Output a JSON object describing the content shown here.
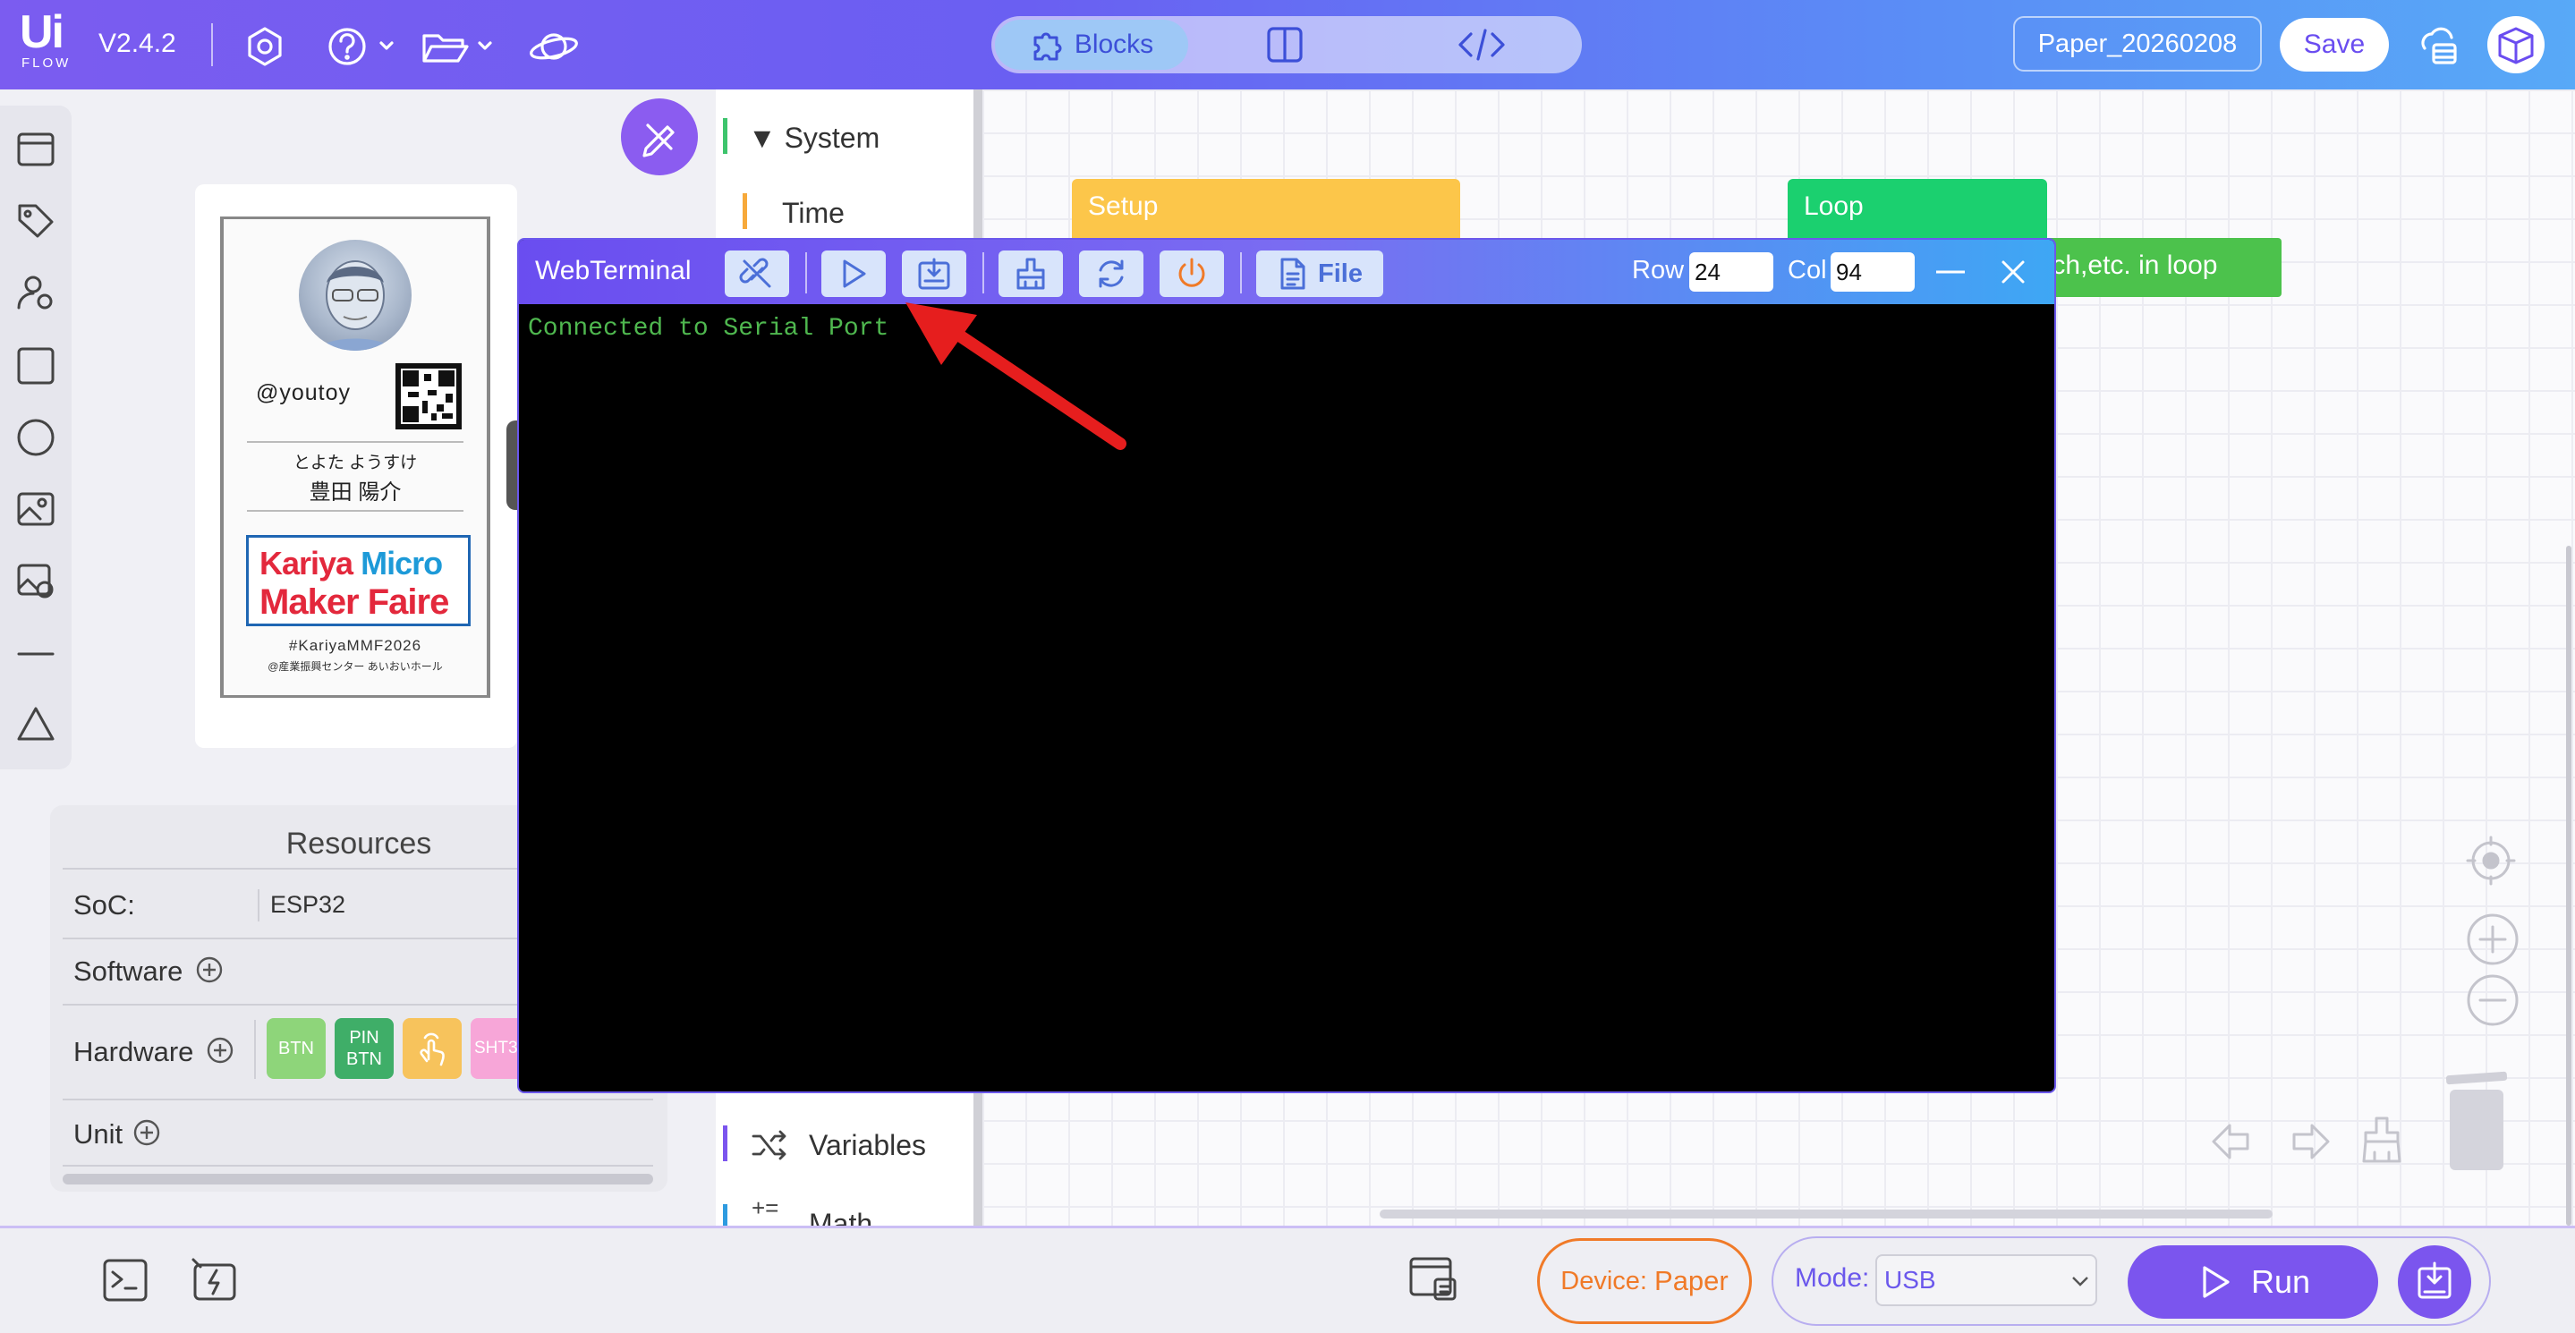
{
  "app": {
    "logo_top": "Ui",
    "logo_bottom": "FLOW",
    "version": "V2.4.2"
  },
  "view_tabs": {
    "blocks_label": "Blocks"
  },
  "header": {
    "project_name": "Paper_20260208",
    "save_label": "Save"
  },
  "preview": {
    "handle": "@youtoy",
    "name_kana": "とよた ようすけ",
    "name_kanji": "豊田 陽介",
    "logo_line1_a": "Kariya",
    "logo_line1_b": "Micro",
    "logo_line2": "Maker Faire",
    "hashtag": "#KariyaMMF2026",
    "venue": "@産業振興センター あいおいホール"
  },
  "resources": {
    "title": "Resources",
    "soc_label": "SoC:",
    "soc_value": "ESP32",
    "software_label": "Software",
    "hardware_label": "Hardware",
    "unit_label": "Unit",
    "hw_chips": [
      "BTN",
      "PIN\nBTN",
      "",
      "SHT3"
    ]
  },
  "categories": {
    "system": "System",
    "time": "Time",
    "variables": "Variables",
    "math": "Math"
  },
  "blocks": {
    "setup": "Setup",
    "loop": "Loop",
    "loop_stmt": "ouch,etc. in loop"
  },
  "terminal": {
    "title": "WebTerminal",
    "file_label": "File",
    "row_label": "Row",
    "row_value": "24",
    "col_label": "Col",
    "col_value": "94",
    "output": "Connected to Serial Port"
  },
  "bottom": {
    "device_label": "Device:",
    "device_value": "Paper",
    "mode_label": "Mode:",
    "mode_value": "USB",
    "run_label": "Run"
  },
  "colors": {
    "accent": "#6a4df0",
    "device": "#f07a28",
    "terminal_text": "#4fb84f"
  }
}
